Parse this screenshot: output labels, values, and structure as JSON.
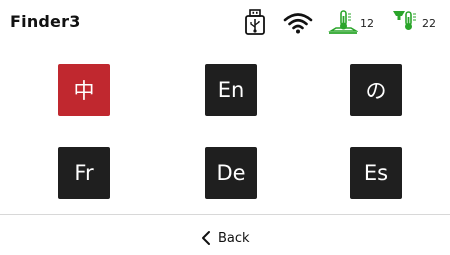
{
  "header": {
    "title": "Finder3",
    "status": {
      "usb_icon": "usb-drive-icon",
      "wifi_icon": "wifi-icon",
      "bed_temp": "12",
      "bed_icon": "heated-bed-thermometer-icon",
      "nozzle_temp": "22",
      "nozzle_icon": "nozzle-thermometer-icon",
      "status_color": "#2aa52a"
    }
  },
  "languages": [
    {
      "label": "中",
      "code": "zh",
      "selected": true
    },
    {
      "label": "En",
      "code": "en",
      "selected": false
    },
    {
      "label": "の",
      "code": "ja",
      "selected": false
    },
    {
      "label": "Fr",
      "code": "fr",
      "selected": false
    },
    {
      "label": "De",
      "code": "de",
      "selected": false
    },
    {
      "label": "Es",
      "code": "es",
      "selected": false
    }
  ],
  "colors": {
    "button_bg": "#1f1f1f",
    "selected_bg": "#c0282f"
  },
  "footer": {
    "back_label": "Back",
    "back_icon": "chevron-left-icon"
  }
}
